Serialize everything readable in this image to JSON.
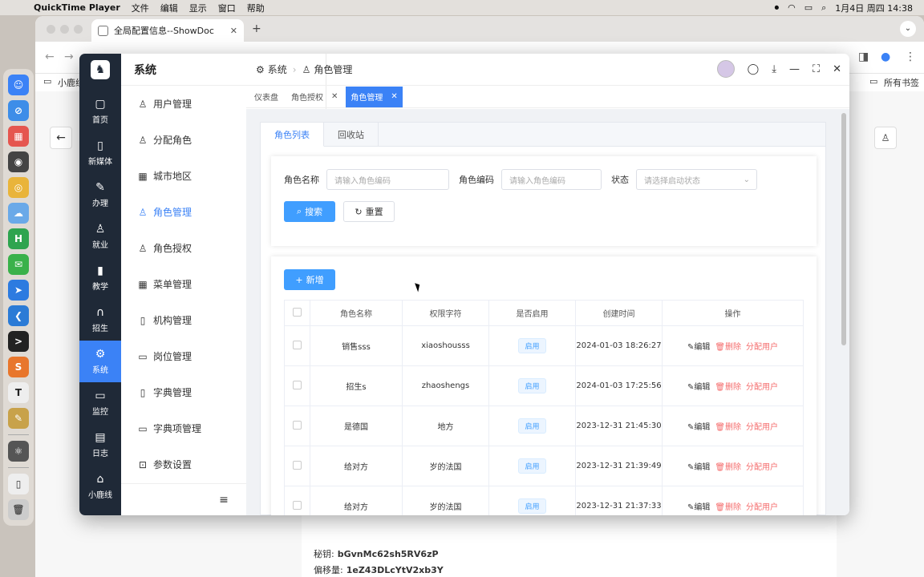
{
  "menubar": {
    "app": "QuickTime Player",
    "items": [
      "文件",
      "编辑",
      "显示",
      "窗口",
      "帮助"
    ],
    "clock": "1月4日 周四  14:38"
  },
  "browser": {
    "tab_title": "全局配置信息--ShowDoc",
    "bookmark_left": "小鹿线",
    "bookmark_right": "所有书签"
  },
  "doc": {
    "key1_label": "秘钥:",
    "key1_value": "bGvnMc62sh5RV6zP",
    "key2_label": "偏移量:",
    "key2_value": "1eZ43DLcYtV2xb3Y"
  },
  "rail": [
    {
      "label": "首页",
      "icon": "home-icon"
    },
    {
      "label": "新媒体",
      "icon": "phone-icon"
    },
    {
      "label": "办理",
      "icon": "pen-icon"
    },
    {
      "label": "就业",
      "icon": "person-pin-icon"
    },
    {
      "label": "教学",
      "icon": "mic-icon"
    },
    {
      "label": "招生",
      "icon": "headset-icon"
    },
    {
      "label": "系统",
      "icon": "gear-icon"
    },
    {
      "label": "监控",
      "icon": "monitor-icon"
    },
    {
      "label": "日志",
      "icon": "log-icon"
    },
    {
      "label": "小鹿线",
      "icon": "house-icon"
    }
  ],
  "submenu": {
    "title": "系统",
    "items": [
      {
        "label": "用户管理",
        "icon": "user-icon"
      },
      {
        "label": "分配角色",
        "icon": "user-icon"
      },
      {
        "label": "城市地区",
        "icon": "building-icon"
      },
      {
        "label": "角色管理",
        "icon": "user-icon"
      },
      {
        "label": "角色授权",
        "icon": "user-pin-icon"
      },
      {
        "label": "菜单管理",
        "icon": "grid-icon"
      },
      {
        "label": "机构管理",
        "icon": "doc-icon"
      },
      {
        "label": "岗位管理",
        "icon": "card-icon"
      },
      {
        "label": "字典管理",
        "icon": "doc-icon"
      },
      {
        "label": "字典项管理",
        "icon": "card-icon"
      },
      {
        "label": "参数设置",
        "icon": "chart-icon"
      }
    ]
  },
  "breadcrumb": {
    "first": "系统",
    "second": "角色管理"
  },
  "tags": [
    "仪表盘",
    "角色授权",
    "角色管理"
  ],
  "panel_tabs": [
    "角色列表",
    "回收站"
  ],
  "search": {
    "name_label": "角色名称",
    "name_placeholder": "请输入角色编码",
    "code_label": "角色编码",
    "code_placeholder": "请输入角色编码",
    "status_label": "状态",
    "status_placeholder": "请选择启动状态",
    "search_btn": "搜索",
    "reset_btn": "重置"
  },
  "add_btn": "新增",
  "table": {
    "headers": [
      "角色名称",
      "权限字符",
      "是否启用",
      "创建时间",
      "操作"
    ],
    "rows": [
      {
        "name": "销售sss",
        "key": "xiaoshousss",
        "status": "启用",
        "time": "2024-01-03 18:26:27"
      },
      {
        "name": "招生s",
        "key": "zhaoshengs",
        "status": "启用",
        "time": "2024-01-03 17:25:56"
      },
      {
        "name": "是德国",
        "key": "地方",
        "status": "启用",
        "time": "2023-12-31 21:45:30"
      },
      {
        "name": "给对方",
        "key": "岁的法国",
        "status": "启用",
        "time": "2023-12-31 21:39:49"
      },
      {
        "name": "给对方",
        "key": "岁的法国",
        "status": "启用",
        "time": "2023-12-31 21:37:33"
      }
    ],
    "ops": {
      "edit": "编辑",
      "delete": "删除",
      "assign": "分配用户"
    }
  },
  "colors": {
    "primary": "#3b82f6",
    "rail": "#1f2937",
    "danger": "#f56c6c"
  }
}
